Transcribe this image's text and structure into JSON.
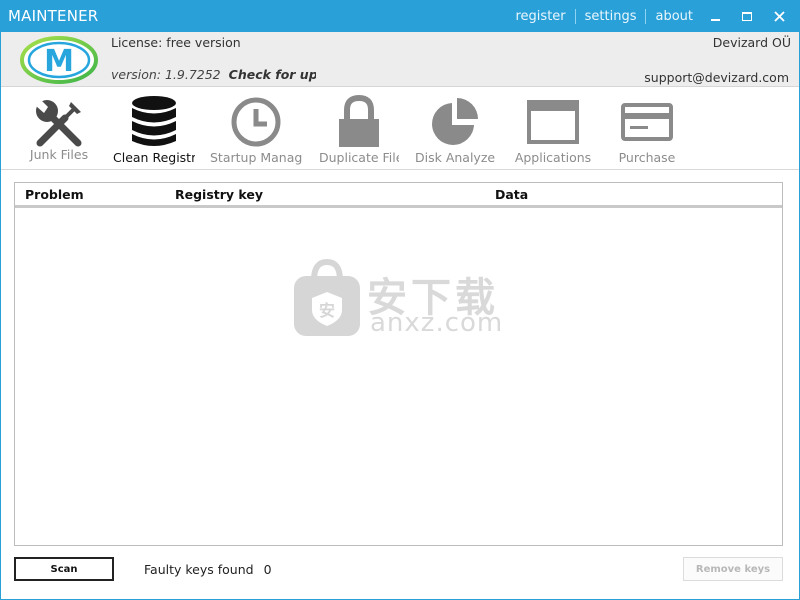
{
  "window": {
    "title": "MAINTENER",
    "links": [
      "register",
      "settings",
      "about"
    ]
  },
  "info": {
    "license": "License: free version",
    "version": "version: 1.9.7252",
    "check_updates": "Check for updates",
    "company": "Devizard OÜ",
    "support_email": "support@devizard.com",
    "logo_letter": "M"
  },
  "toolbar": {
    "items": [
      {
        "label": "Junk Files",
        "icon": "tools-icon"
      },
      {
        "label": "Clean Registry",
        "icon": "database-icon"
      },
      {
        "label": "Startup Manager",
        "icon": "clock-icon"
      },
      {
        "label": "Duplicate Files",
        "icon": "lock-icon"
      },
      {
        "label": "Disk Analyzer",
        "icon": "pie-chart-icon"
      },
      {
        "label": "Applications",
        "icon": "window-icon"
      },
      {
        "label": "Purchase",
        "icon": "credit-card-icon"
      }
    ],
    "active_index": 1
  },
  "grid": {
    "columns": [
      "Problem",
      "Registry key",
      "Data"
    ],
    "rows": []
  },
  "watermark": {
    "text": "安下载",
    "sub": "anxz.com",
    "badge_char": "安"
  },
  "footer": {
    "scan_label": "Scan",
    "faulty_label": "Faulty keys found",
    "faulty_count": "0",
    "remove_label": "Remove keys"
  },
  "colors": {
    "titlebar": "#2aa0d9",
    "icon_dark": "#111111",
    "icon_gray": "#8a8a8a"
  }
}
